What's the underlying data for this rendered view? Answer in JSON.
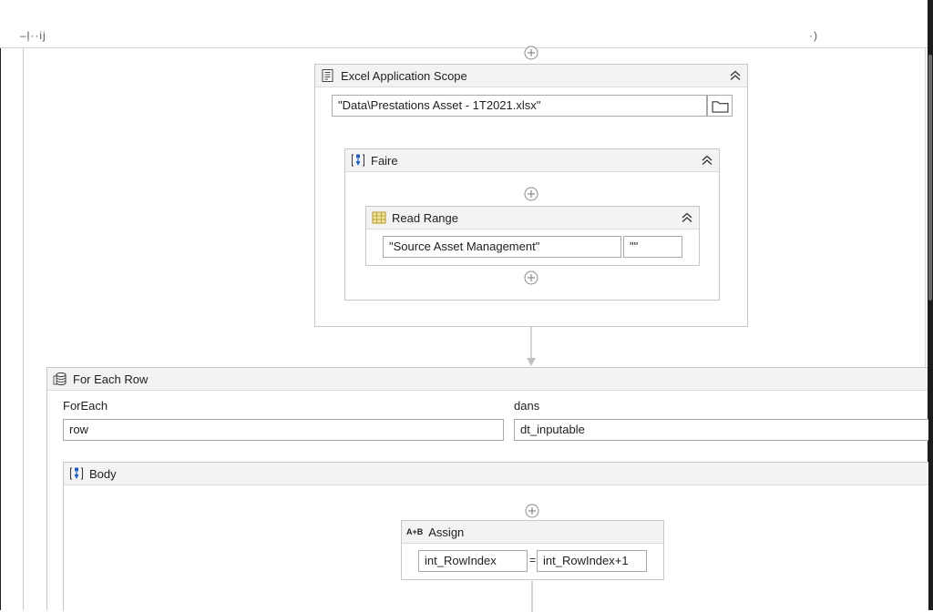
{
  "topbar": {
    "left_fragment": "–ļ··ij",
    "right_fragment": "·)"
  },
  "excel_scope": {
    "title": "Excel Application Scope",
    "workbook_path": "\"Data\\Prestations Asset - 1T2021.xlsx\"",
    "icon": "excel-scope-icon",
    "browse_icon": "folder-icon"
  },
  "faire": {
    "title": "Faire",
    "icon": "sequence-icon"
  },
  "read_range": {
    "title": "Read Range",
    "sheet_name": "\"Source Asset Management\"",
    "range": "\"\"",
    "icon": "read-range-icon"
  },
  "for_each_row": {
    "title": "For Each Row",
    "icon": "database-icon",
    "foreach_label": "ForEach",
    "foreach_value": "row",
    "in_label": "dans",
    "in_value": "dt_inputable"
  },
  "body": {
    "title": "Body",
    "icon": "sequence-icon"
  },
  "assign": {
    "title": "Assign",
    "icon_text": "A+B",
    "to": "int_RowIndex",
    "equals": "=",
    "value": "int_RowIndex+1"
  },
  "colors": {
    "header_bg": "#f3f3f3",
    "border": "#c7c7c7",
    "icon_blue": "#1f5fbf"
  }
}
